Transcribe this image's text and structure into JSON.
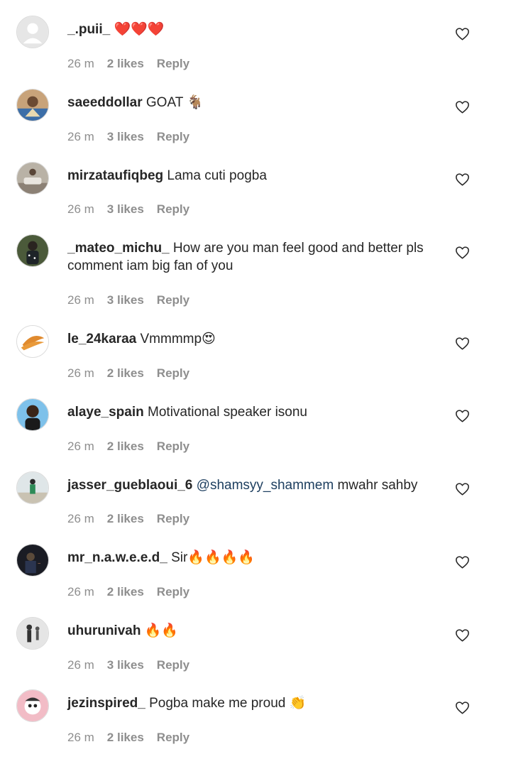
{
  "comments": [
    {
      "username": "_.puii_",
      "text": "❤️❤️❤️",
      "mention": "",
      "time": "26 m",
      "likes": "2 likes",
      "reply": "Reply",
      "avatar": "default-avatar-icon"
    },
    {
      "username": "saeeddollar",
      "text": "GOAT 🐐",
      "mention": "",
      "time": "26 m",
      "likes": "3 likes",
      "reply": "Reply",
      "avatar": "user-avatar"
    },
    {
      "username": "mirzataufiqbeg",
      "text": "Lama cuti pogba",
      "mention": "",
      "time": "26 m",
      "likes": "3 likes",
      "reply": "Reply",
      "avatar": "user-avatar"
    },
    {
      "username": "_mateo_michu_",
      "text": "How are you man feel good and better pls comment iam big fan of you",
      "mention": "",
      "time": "26 m",
      "likes": "3 likes",
      "reply": "Reply",
      "avatar": "user-avatar"
    },
    {
      "username": "le_24karaa",
      "text": "Vmmmmp😍",
      "mention": "",
      "time": "26 m",
      "likes": "2 likes",
      "reply": "Reply",
      "avatar": "user-avatar"
    },
    {
      "username": "alaye_spain",
      "text": "Motivational speaker isonu",
      "mention": "",
      "time": "26 m",
      "likes": "2 likes",
      "reply": "Reply",
      "avatar": "user-avatar"
    },
    {
      "username": "jasser_gueblaoui_6",
      "text": "mwahr sahby",
      "mention": "@shamsyy_shammem",
      "time": "26 m",
      "likes": "2 likes",
      "reply": "Reply",
      "avatar": "user-avatar"
    },
    {
      "username": "mr_n.a.w.e.e.d_",
      "text": "Sir🔥🔥🔥🔥",
      "mention": "",
      "time": "26 m",
      "likes": "2 likes",
      "reply": "Reply",
      "avatar": "user-avatar"
    },
    {
      "username": "uhurunivah",
      "text": "🔥🔥",
      "mention": "",
      "time": "26 m",
      "likes": "3 likes",
      "reply": "Reply",
      "avatar": "user-avatar"
    },
    {
      "username": "jezinspired_",
      "text": "Pogba make me proud 👏",
      "mention": "",
      "time": "26 m",
      "likes": "2 likes",
      "reply": "Reply",
      "avatar": "user-avatar"
    }
  ],
  "icons": {
    "like": "heart-outline-icon"
  },
  "colors": {
    "text": "#262626",
    "meta": "#8e8e8e",
    "mention": "#1e3f60"
  }
}
